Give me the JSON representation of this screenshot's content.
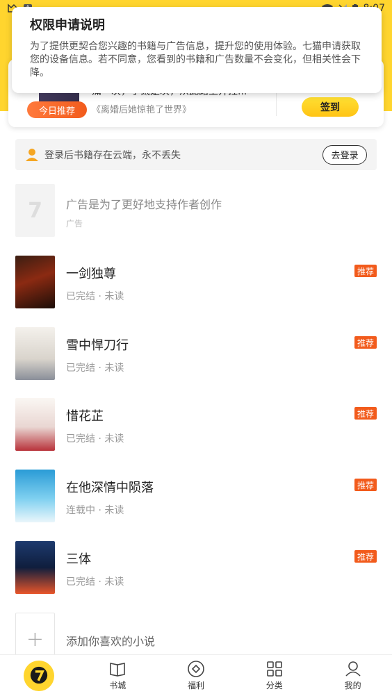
{
  "status_bar": {
    "time": "8:07",
    "a_badge": "A"
  },
  "colors": {
    "brand_yellow": "#FFD52E",
    "accent_orange": "#F25B1C"
  },
  "permission_popup": {
    "title": "权限申请说明",
    "body": "为了提供更契合您兴趣的书籍与广告信息，提升您的使用体验。七猫申请获取您的设备信息。若不同意，您看到的书籍和广告数量不会变化，但相关性会下降。"
  },
  "sign_card": {
    "badge": "今日推荐",
    "quote": "痛一次，争贰是次，从此路上开拄...",
    "book": "《离婚后她惊艳了世界》",
    "sign_button": "签到"
  },
  "login_banner": {
    "text": "登录后书籍存在云端，永不丢失",
    "button": "去登录"
  },
  "ad": {
    "title": "广告是为了更好地支持作者创作",
    "label": "广告"
  },
  "books": [
    {
      "title": "一剑独尊",
      "status": "已完结 · 未读",
      "tag": "推荐"
    },
    {
      "title": "雪中悍刀行",
      "status": "已完结 · 未读",
      "tag": "推荐"
    },
    {
      "title": "惜花芷",
      "status": "已完结 · 未读",
      "tag": "推荐"
    },
    {
      "title": "在他深情中陨落",
      "status": "连载中 · 未读",
      "tag": "推荐"
    },
    {
      "title": "三体",
      "status": "已完结 · 未读",
      "tag": "推荐"
    }
  ],
  "add_item": {
    "text": "添加你喜欢的小说",
    "icon": "plus-icon"
  },
  "tabs": [
    {
      "label": "",
      "icon": "cat-logo-icon"
    },
    {
      "label": "书城",
      "icon": "book-icon"
    },
    {
      "label": "福利",
      "icon": "gift-icon"
    },
    {
      "label": "分类",
      "icon": "grid-icon"
    },
    {
      "label": "我的",
      "icon": "user-icon"
    }
  ]
}
